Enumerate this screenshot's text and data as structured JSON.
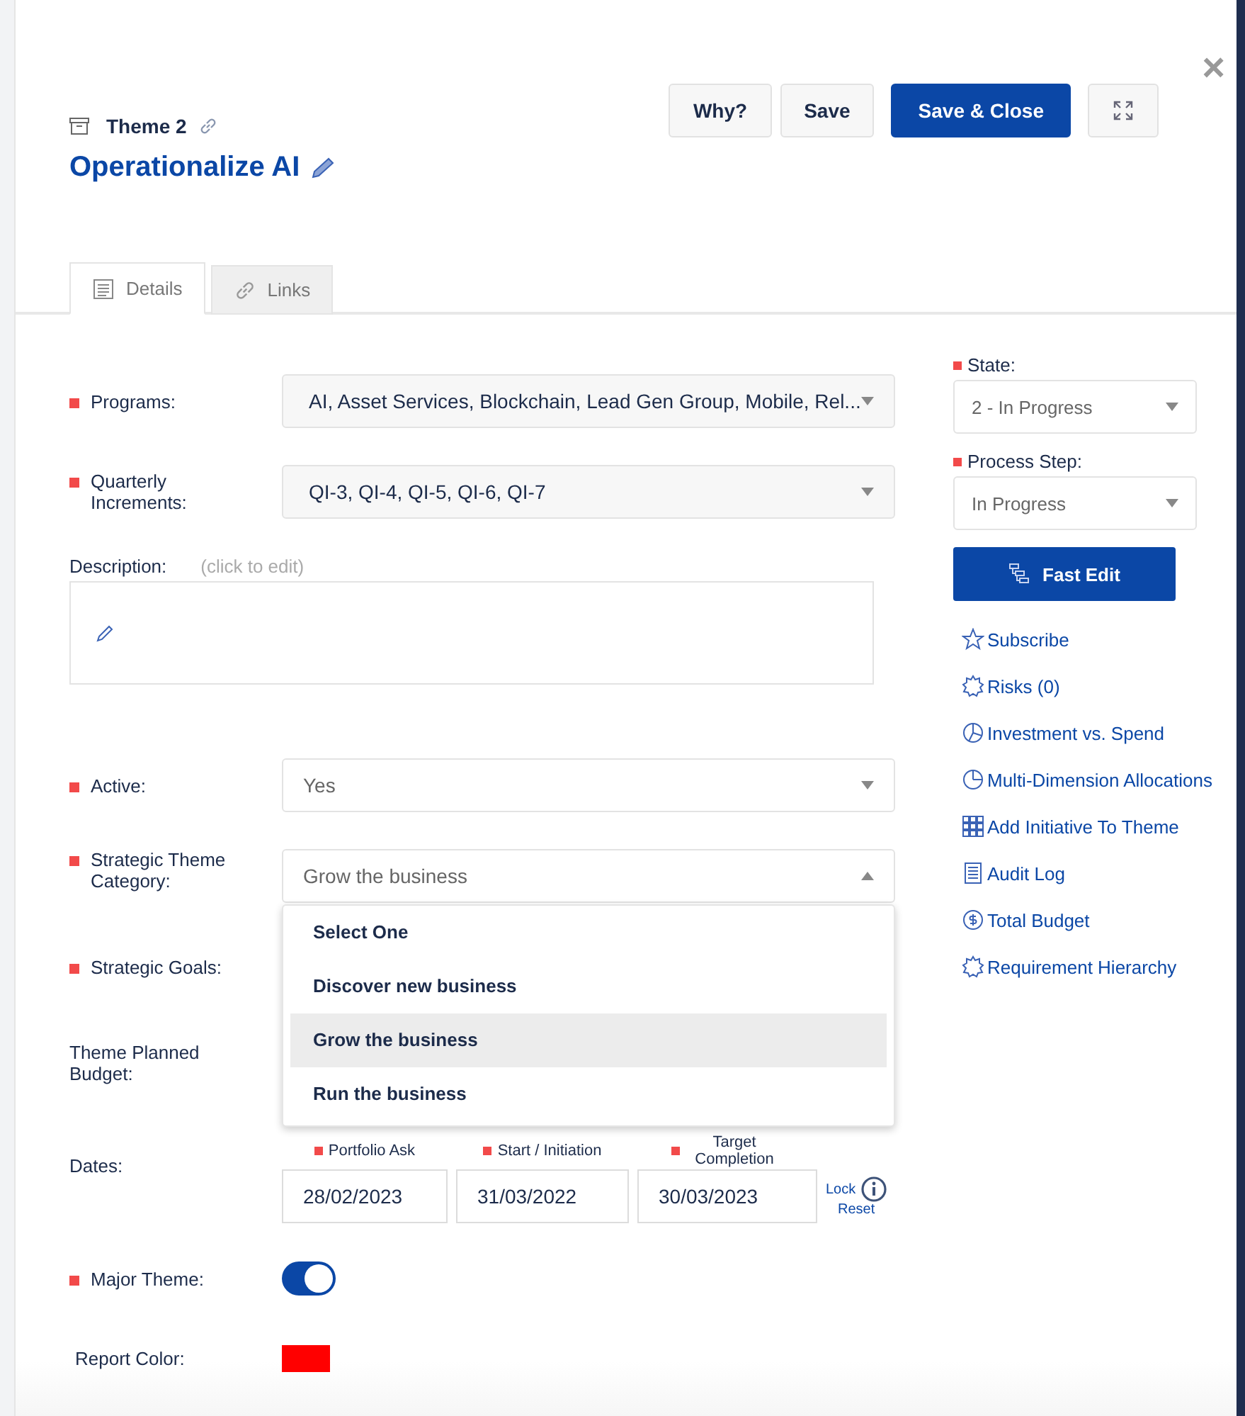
{
  "header": {
    "item_type": "Theme 2",
    "title": "Operationalize AI"
  },
  "buttons": [
    {
      "label": "Why?",
      "kind": "default"
    },
    {
      "label": "Save",
      "kind": "default"
    },
    {
      "label": "Save & Close",
      "kind": "primary"
    }
  ],
  "close": "×",
  "tabs": [
    {
      "label": "Details",
      "selected": true
    },
    {
      "label": "Links",
      "selected": false
    }
  ],
  "fields": [
    {
      "kind": "select",
      "label": "Programs:",
      "required": true,
      "value": "AI, Asset Services, Blockchain, Lead Gen Group, Mobile, Rel..."
    },
    {
      "kind": "select",
      "label": "Quarterly Increments:",
      "required": true,
      "value": "QI-3, QI-4, QI-5, QI-6, QI-7"
    },
    {
      "kind": "description",
      "label": "Description:",
      "required": false,
      "placeholder": "(click to edit)"
    },
    {
      "kind": "select",
      "label": "Active:",
      "required": true,
      "value": "Yes"
    },
    {
      "kind": "open_select",
      "label": "Strategic Theme Category:",
      "required": true,
      "value": "Grow the business",
      "options": [
        {
          "label": "Select One",
          "selected": false
        },
        {
          "label": "Discover new business",
          "selected": false
        },
        {
          "label": "Grow the business",
          "selected": true
        },
        {
          "label": "Run the business",
          "selected": false
        }
      ]
    },
    {
      "kind": "label_only",
      "label": "Strategic Goals:",
      "required": true
    },
    {
      "kind": "label_only",
      "label": "Theme Planned Budget:",
      "required": false
    },
    {
      "kind": "dates",
      "label": "Dates:",
      "required": false,
      "dates": [
        {
          "label": "Portfolio Ask",
          "required": true,
          "value": "28/02/2023"
        },
        {
          "label": "Start / Initiation",
          "required": true,
          "value": "31/03/2022"
        },
        {
          "label": "Target Completion",
          "required": true,
          "value": "30/03/2023"
        }
      ],
      "lock": "Lock",
      "reset": "Reset"
    },
    {
      "kind": "toggle",
      "label": "Major Theme:",
      "required": true,
      "on": true
    },
    {
      "kind": "color",
      "label": "Report Color:",
      "required": false,
      "color": "#ff0000"
    }
  ],
  "sidebar": {
    "selects": [
      {
        "label": "State:",
        "required": true,
        "value": "2 - In Progress"
      },
      {
        "label": "Process Step:",
        "required": true,
        "value": "In Progress"
      }
    ],
    "fast_edit": "Fast Edit",
    "links": [
      "Subscribe",
      "Risks (0)",
      "Investment vs. Spend",
      "Multi-Dimension Allocations",
      "Add Initiative To Theme",
      "Audit Log",
      "Total Budget",
      "Requirement Hierarchy"
    ]
  }
}
